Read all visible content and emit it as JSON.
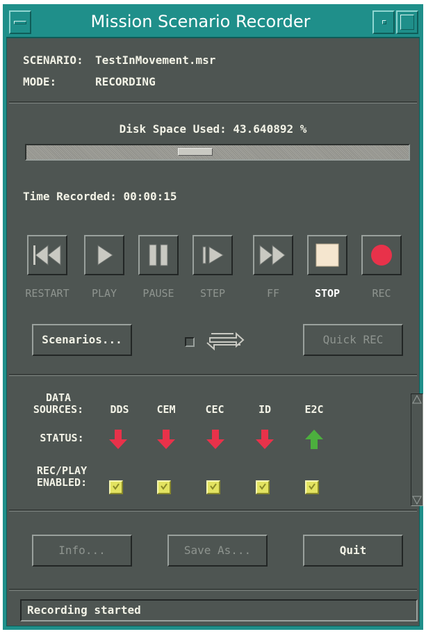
{
  "window": {
    "title": "Mission Scenario Recorder"
  },
  "info": {
    "scenario_label": "SCENARIO:",
    "scenario_value": "TestInMovement.msr",
    "mode_label": "MODE:",
    "mode_value": "RECORDING"
  },
  "disk": {
    "label": "Disk Space Used: 43.640892 %",
    "percent": 43.640892
  },
  "time": {
    "label": "Time Recorded: 00:00:15"
  },
  "transport": {
    "buttons": [
      {
        "label": "RESTART",
        "icon": "rewind-icon",
        "enabled": false
      },
      {
        "label": "PLAY",
        "icon": "play-icon",
        "enabled": false
      },
      {
        "label": "PAUSE",
        "icon": "pause-icon",
        "enabled": false
      },
      {
        "label": "STEP",
        "icon": "step-icon",
        "enabled": false
      },
      {
        "label": "FF",
        "icon": "fast-forward-icon",
        "enabled": false
      },
      {
        "label": "STOP",
        "icon": "stop-icon",
        "enabled": true
      },
      {
        "label": "REC",
        "icon": "record-icon",
        "enabled": false
      }
    ]
  },
  "controls": {
    "scenarios_label": "Scenarios...",
    "loop_icon": "loop-icon",
    "loop_checked": false,
    "quick_rec_label": "Quick REC"
  },
  "datasources": {
    "header_line1": "DATA",
    "header_line2": "SOURCES:",
    "status_label": "STATUS:",
    "enabled_line1": "REC/PLAY",
    "enabled_line2": "ENABLED:",
    "sources": [
      {
        "name": "DDS",
        "status": "down",
        "enabled": true
      },
      {
        "name": "CEM",
        "status": "down",
        "enabled": true
      },
      {
        "name": "CEC",
        "status": "down",
        "enabled": true
      },
      {
        "name": "ID",
        "status": "down",
        "enabled": true
      },
      {
        "name": "E2C",
        "status": "up",
        "enabled": true
      }
    ],
    "colors": {
      "down": "#e8324a",
      "up": "#4caf3e",
      "checkbox": "#e3e360"
    }
  },
  "bottom": {
    "info_label": "Info...",
    "save_as_label": "Save As...",
    "quit_label": "Quit"
  },
  "status": {
    "message": "Recording started"
  },
  "colors": {
    "titlebar": "#1f8f8a",
    "panel": "#4e5552",
    "record": "#e8324a"
  }
}
